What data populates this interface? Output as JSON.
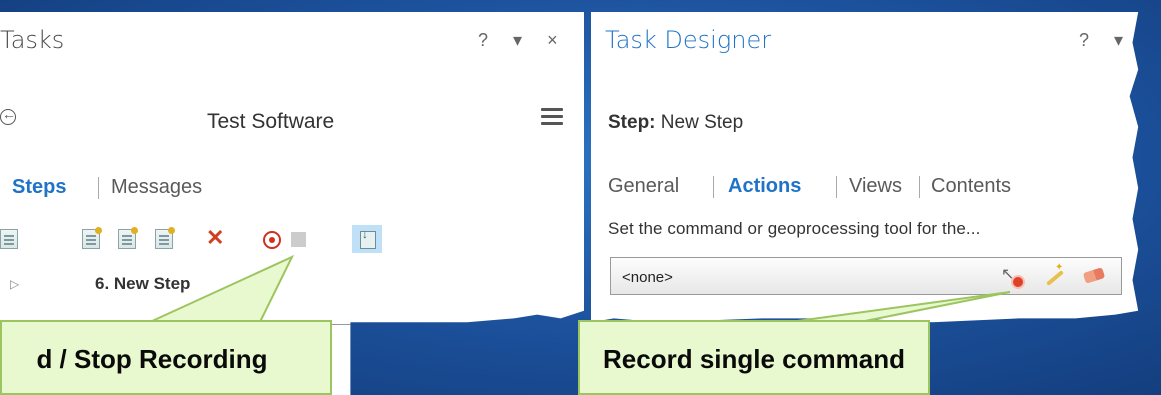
{
  "tasks_pane": {
    "title": "Tasks",
    "help": "?",
    "menu": "▾",
    "close": "×",
    "task_name": "Test Software",
    "tabs": [
      {
        "label": "Steps",
        "active": true
      },
      {
        "label": "Messages",
        "active": false
      }
    ],
    "toolbar_icons": [
      "task-item-icon",
      "new-step-icon",
      "step-properties-icon",
      "step-actions-icon",
      "delete-step-icon",
      "start-recording-icon",
      "stop-recording-icon",
      "insert-step-icon"
    ],
    "steps": [
      {
        "label": "6.  New Step"
      }
    ]
  },
  "designer_pane": {
    "title": "Task Designer",
    "help": "?",
    "menu": "▾",
    "step_prefix": "Step:",
    "step_name": "New Step",
    "tabs": [
      {
        "label": "General",
        "active": false
      },
      {
        "label": "Actions",
        "active": true
      },
      {
        "label": "Views",
        "active": false
      },
      {
        "label": "Contents",
        "active": false
      }
    ],
    "description": "Set the command or geoprocessing tool for the...",
    "command_value": "<none>"
  },
  "callouts": {
    "recording": "d / Stop Recording",
    "single": "Record single command"
  },
  "colors": {
    "accent": "#1f73c8",
    "background": "#1b4f99",
    "callout_fill": "#e8f8cf",
    "callout_border": "#9cc560",
    "record_red": "#d03020"
  }
}
